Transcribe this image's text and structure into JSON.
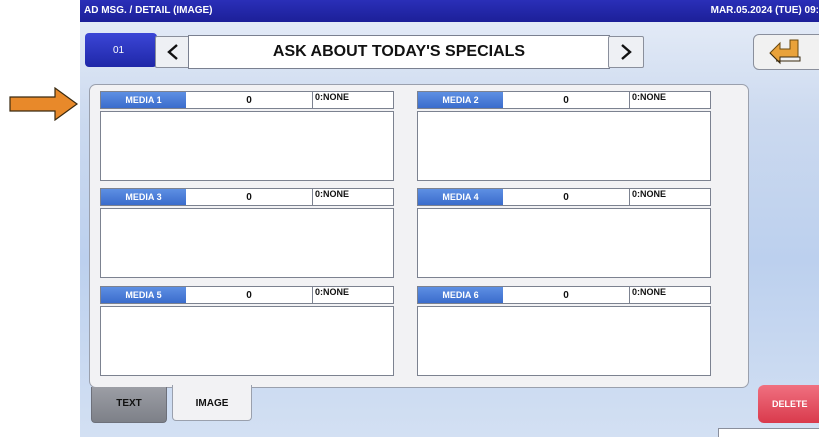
{
  "header": {
    "title": "AD MSG. / DETAIL (IMAGE)",
    "datetime": "MAR.05.2024 (TUE) 09:"
  },
  "toolbar": {
    "message_number": "01",
    "message_title": "ASK ABOUT TODAY'S SPECIALS"
  },
  "media": [
    {
      "label": "MEDIA 1",
      "value": "0",
      "type": "0:NONE"
    },
    {
      "label": "MEDIA 2",
      "value": "0",
      "type": "0:NONE"
    },
    {
      "label": "MEDIA 3",
      "value": "0",
      "type": "0:NONE"
    },
    {
      "label": "MEDIA 4",
      "value": "0",
      "type": "0:NONE"
    },
    {
      "label": "MEDIA 5",
      "value": "0",
      "type": "0:NONE"
    },
    {
      "label": "MEDIA 6",
      "value": "0",
      "type": "0:NONE"
    }
  ],
  "tabs": [
    {
      "label": "TEXT",
      "active": false
    },
    {
      "label": "IMAGE",
      "active": true
    }
  ],
  "actions": {
    "delete_label": "DELETE"
  },
  "colors": {
    "header_bar": "#1c1f98",
    "media_label": "#3b6ccc",
    "delete_button": "#d93a4c",
    "pointer_arrow": "#e8892a"
  },
  "icons": {
    "pointer": "right-arrow-icon",
    "previous": "chevron-left-icon",
    "next": "chevron-right-icon",
    "back": "return-arrow-icon"
  }
}
